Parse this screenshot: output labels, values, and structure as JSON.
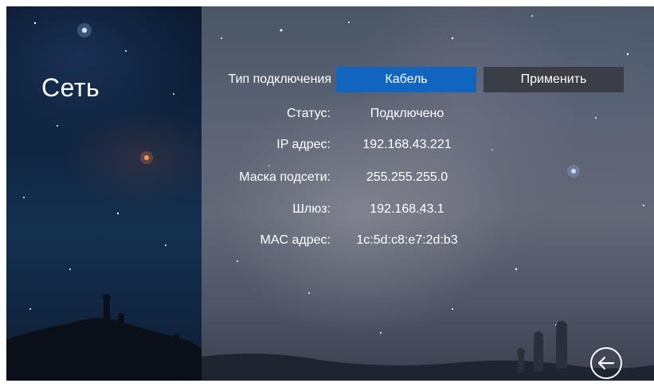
{
  "page": {
    "title": "Сеть"
  },
  "network": {
    "connection_type_label": "Тип подключения",
    "connection_type_value": "Кабель",
    "apply_label": "Применить",
    "rows": [
      {
        "label": "Статус:",
        "value": "Подключено"
      },
      {
        "label": "IP адрес:",
        "value": "192.168.43.221"
      },
      {
        "label": "Маска подсети:",
        "value": "255.255.255.0"
      },
      {
        "label": "Шлюз:",
        "value": "192.168.43.1"
      },
      {
        "label": "MAC адрес:",
        "value": "1c:5d:c8:e7:2d:b3"
      }
    ]
  },
  "icons": {
    "back": "back-arrow-circle-icon"
  },
  "colors": {
    "selected_button": "#1265bf",
    "apply_button": "#3b3e44",
    "text": "#ffffff"
  }
}
